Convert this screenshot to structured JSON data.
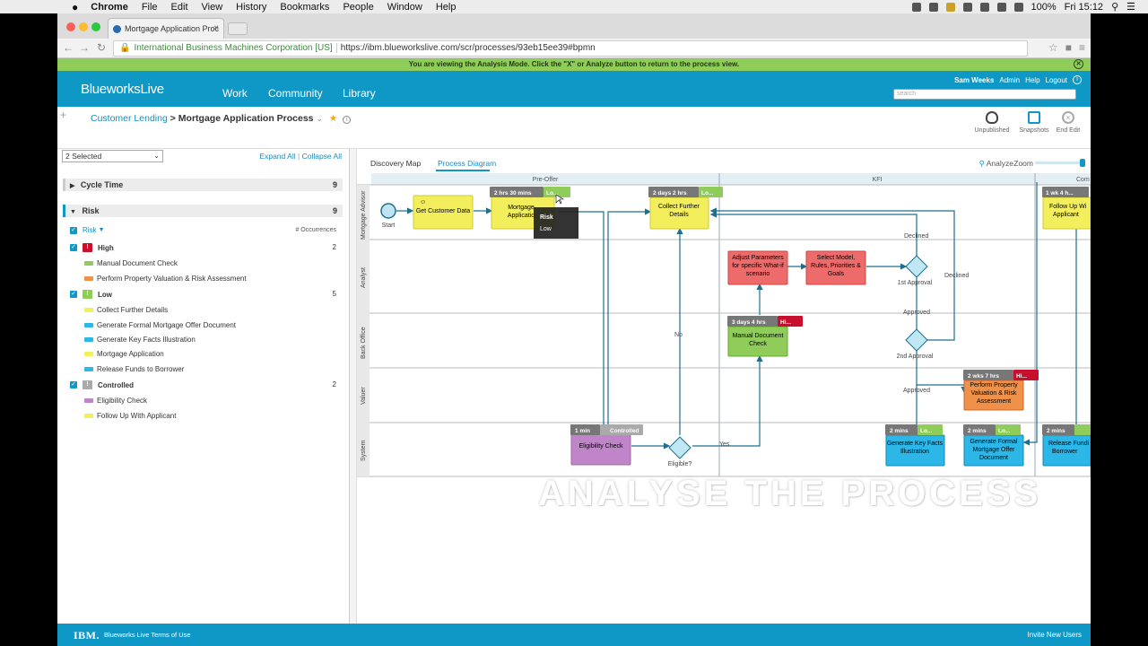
{
  "mac_menu": {
    "apple": "",
    "app": "Chrome",
    "items": [
      "File",
      "Edit",
      "View",
      "History",
      "Bookmarks",
      "People",
      "Window",
      "Help"
    ],
    "battery": "100%",
    "clock": "Fri 15:12"
  },
  "browser": {
    "tab_title": "Mortgage Application Proc",
    "org": "International Business Machines Corporation [US]",
    "url": "https://ibm.blueworkslive.com/scr/processes/93eb15ee39#bpmn"
  },
  "banner": {
    "text": "You are viewing the Analysis Mode. Click the \"X\" or Analyze button to return to the process view."
  },
  "header": {
    "logo_a": "Blueworks",
    "logo_b": "Live",
    "nav": [
      "Work",
      "Community",
      "Library"
    ],
    "user": "Sam Weeks",
    "links": [
      "Admin",
      "Help",
      "Logout"
    ],
    "search_placeholder": "search"
  },
  "breadcrumb": {
    "parent": "Customer Lending",
    "sep": ">",
    "current": "Mortgage Application Process"
  },
  "tools": [
    {
      "label": "Unpublished"
    },
    {
      "label": "Snapshots"
    },
    {
      "label": "End Edit"
    }
  ],
  "left": {
    "selected": "2 Selected",
    "expand": "Expand All",
    "collapse": "Collapse All",
    "divider": "|",
    "cycle_time": {
      "label": "Cycle Time",
      "count": "9"
    },
    "risk": {
      "label": "Risk",
      "count": "9"
    },
    "risk_col": "Risk",
    "occ_col": "# Occurrences",
    "groups": [
      {
        "label": "High",
        "count": "2",
        "color": "#c8102e",
        "items": [
          {
            "label": "Manual Document Check",
            "color": "#8fcc5a"
          },
          {
            "label": "Perform Property Valuation & Risk Assessment",
            "color": "#f0914a"
          }
        ]
      },
      {
        "label": "Low",
        "count": "5",
        "color": "#8fcc5a",
        "items": [
          {
            "label": "Collect Further Details",
            "color": "#f3ee5c"
          },
          {
            "label": "Generate Formal Mortgage Offer Document",
            "color": "#2cb7e8"
          },
          {
            "label": "Generate Key Facts Illustration",
            "color": "#2cb7e8"
          },
          {
            "label": "Mortgage Application",
            "color": "#f3ee5c"
          },
          {
            "label": "Release Funds to Borrower",
            "color": "#2cb7e8"
          }
        ]
      },
      {
        "label": "Controlled",
        "count": "2",
        "color": "#aaaaaa",
        "items": [
          {
            "label": "Eligibility Check",
            "color": "#c084c8"
          },
          {
            "label": "Follow Up With Applicant",
            "color": "#f3ee5c"
          }
        ]
      }
    ]
  },
  "main": {
    "tabs": [
      "Discovery Map",
      "Process Diagram"
    ],
    "analyze": "Analyze",
    "zoom": "Zoom"
  },
  "diagram": {
    "phases": [
      "Pre-Offer",
      "KFI",
      "Com"
    ],
    "lanes": [
      "Mortgage Advisor",
      "Analyst",
      "Back Office",
      "Valuer",
      "System"
    ],
    "start": "Start",
    "tasks": {
      "get": "Get Customer Data",
      "mortgage_a": "Mortgage",
      "mortgage_b": "Applicatio",
      "collect_a": "Collect Further",
      "collect_b": "Details",
      "followup_a": "Follow Up Wi",
      "followup_b": "Applicant",
      "adjust_a": "Adjust Parameters",
      "adjust_b": "for specific What-if",
      "adjust_c": "scenario",
      "select_a": "Select Model,",
      "select_b": "Rules, Priorities &",
      "select_c": "Goals",
      "manual_a": "Manual Document",
      "manual_b": "Check",
      "perform_a": "Perform Property",
      "perform_b": "Valuation & Risk",
      "perform_c": "Assessment",
      "elig": "Eligibility Check",
      "kfi_a": "Generate Key Facts",
      "kfi_b": "Illustration",
      "offer_a": "Generate Formal",
      "offer_b": "Mortgage Offer",
      "offer_c": "Document",
      "release_a": "Release Fundi",
      "release_b": "Borrower"
    },
    "gateways": {
      "first": "1st Approval",
      "second": "2nd Approval",
      "elig": "Eligible?"
    },
    "edges": {
      "declined1": "Declined",
      "declined2": "Declined",
      "approved1": "Approved",
      "approved2": "Approved",
      "no": "No",
      "yes": "Yes"
    },
    "badges": {
      "mortgage_t": "2 hrs 30 mins",
      "mortgage_r": "Lo...",
      "collect_t": "2 days 2 hrs",
      "collect_r": "Lo...",
      "followup_t": "1 wk 4 h...",
      "manual_t": "3 days 4 hrs",
      "manual_r": "Hi...",
      "perform_t": "2 wks 7 hrs",
      "perform_r": "Hi...",
      "elig_t": "1 min",
      "elig_r": "Controlled",
      "kfi_t": "2 mins",
      "kfi_r": "Lo...",
      "offer_t": "2 mins",
      "offer_r": "Lo...",
      "release_t": "2 mins"
    },
    "tooltip": {
      "title": "Risk",
      "value": "Low"
    }
  },
  "footer": {
    "ibm": "IBM.",
    "terms": "Blueworks Live Terms of Use",
    "invite": "Invite New Users"
  },
  "overlay": {
    "text": "ANALYSE THE PROCESS"
  }
}
